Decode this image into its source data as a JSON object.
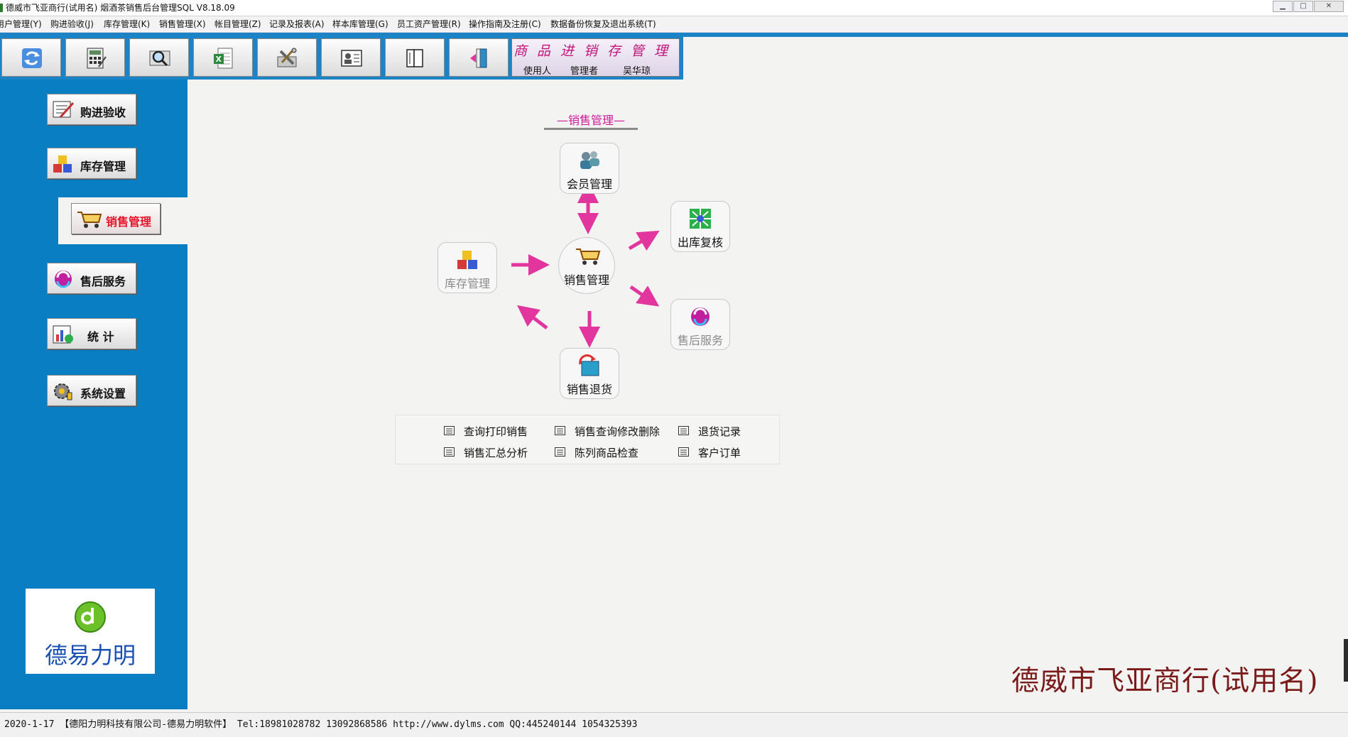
{
  "window": {
    "title": "德威市飞亚商行(试用名) 烟酒茶销售后台管理SQL V8.18.09"
  },
  "menu": {
    "items": [
      "用户管理(Y)",
      "购进验收(J)",
      "库存管理(K)",
      "销售管理(X)",
      "帐目管理(Z)",
      "记录及报表(A)",
      "样本库管理(G)",
      "员工资产管理(R)",
      "操作指南及注册(C)",
      "数据备份恢复及退出系统(T)"
    ]
  },
  "toolbar": {
    "icons": [
      "refresh-icon",
      "calculator-icon",
      "search-icon",
      "excel-icon",
      "tools-icon",
      "id-card-icon",
      "book-icon",
      "exit-door-icon"
    ],
    "brand": "商品进销存管理",
    "user_label": "使用人",
    "user_role": "管理者",
    "user_name": "吴华琼"
  },
  "nav": {
    "purchase": "购进验收",
    "inventory": "库存管理",
    "sales": "销售管理",
    "after_sales": "售后服务",
    "stats": "统  计",
    "settings": "系统设置"
  },
  "logo": {
    "text": "德易力明"
  },
  "main": {
    "section_title": "—销售管理—",
    "nodes": {
      "member": "会员管理",
      "outbound_check": "出库复核",
      "inventory": "库存管理",
      "sales": "销售管理",
      "after_sales": "售后服务",
      "returns": "销售退货"
    },
    "links": [
      "查询打印销售",
      "销售查询修改删除",
      "退货记录",
      "销售汇总分析",
      "陈列商品检查",
      "客户订单"
    ],
    "company_name": "德威市飞亚商行(试用名)"
  },
  "status_bar": {
    "text": "2020-1-17 【德阳力明科技有限公司-德易力明软件】 Tel:18981028782 13092868586 http://www.dylms.com QQ:445240144 1054325393"
  },
  "colors": {
    "nav_blue": "#0a7ec2",
    "accent_magenta": "#e2369e",
    "active_red": "#e8122a",
    "brand_pink": "#c2147a",
    "company_maroon": "#7a1a1a",
    "logo_blue": "#1a4fb3"
  }
}
